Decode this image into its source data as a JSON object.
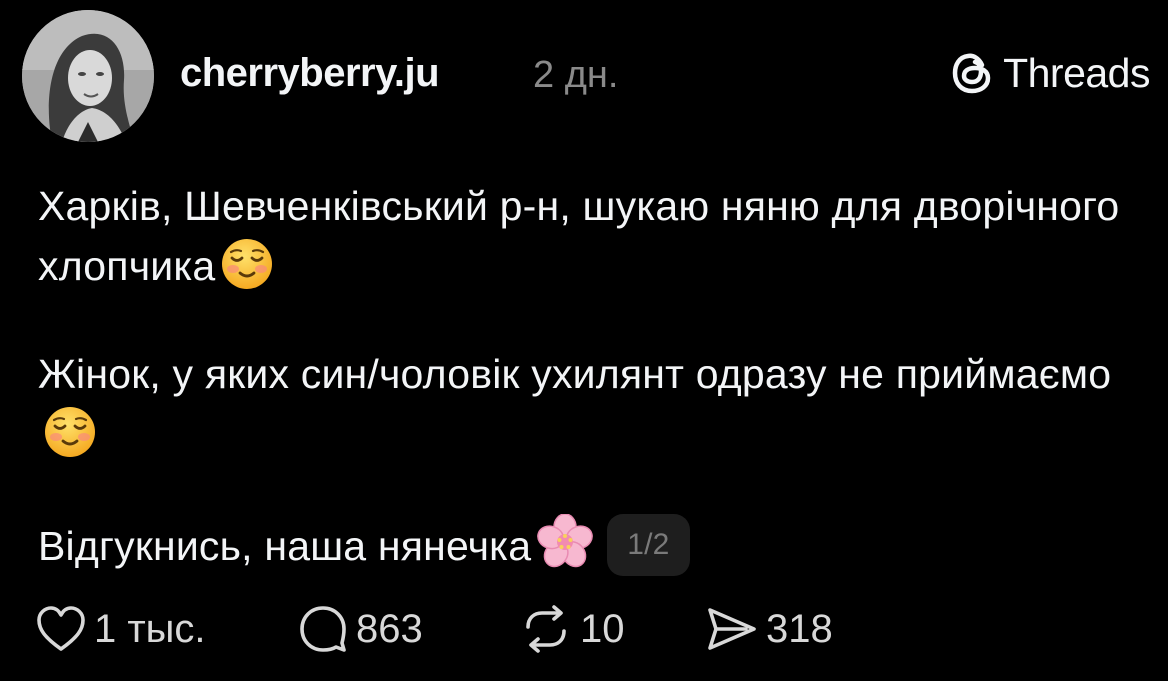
{
  "post": {
    "username": "cherryberry.ju",
    "timestamp": "2 дн.",
    "brand_label": "Threads",
    "paragraphs": [
      {
        "text": "Харків, Шевченківський р-н, шукаю няню для дворічного хлопчика",
        "emoji": "smiling-face-emoji"
      },
      {
        "text": "Жінок, у яких син/чоловік ухилянт одразу не приймаємо",
        "emoji": "smiling-face-emoji"
      },
      {
        "text": "Відгукнись, наша нянечка",
        "emoji": "cherry-blossom-emoji"
      }
    ],
    "page_indicator": "1/2"
  },
  "actions": {
    "likes": "1 тыс.",
    "comments": "863",
    "reposts": "10",
    "shares": "318"
  },
  "icons": {
    "like": "heart-icon",
    "comment": "comment-bubble-icon",
    "repost": "repost-icon",
    "share": "send-icon",
    "brand": "threads-logo-icon"
  },
  "colors": {
    "background": "#000000",
    "text": "#f3f5f7",
    "muted": "#8a8a8a",
    "badge_bg": "#1e1e1e"
  }
}
